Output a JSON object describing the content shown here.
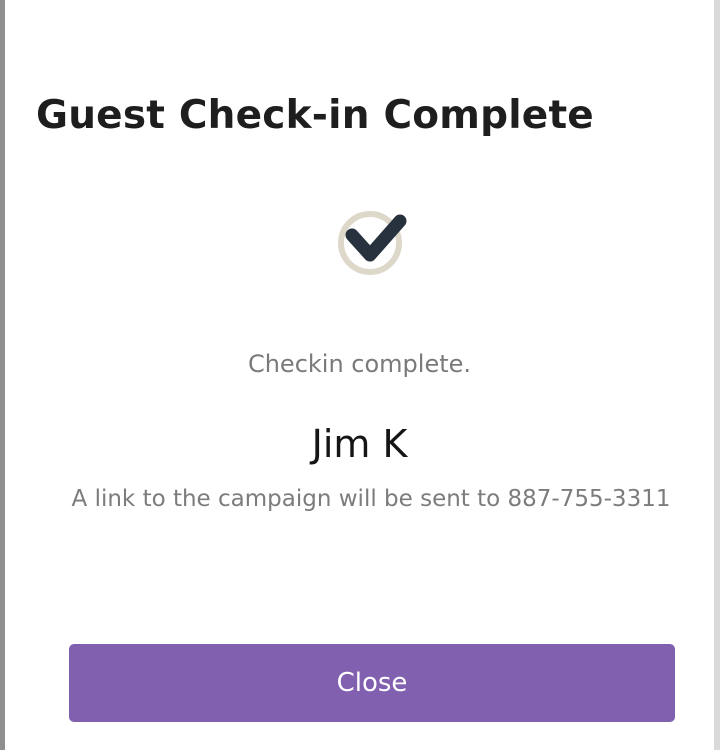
{
  "dialog": {
    "title": "Guest Check-in Complete",
    "status_icon": "check-circle-icon",
    "status_text": "Checkin complete.",
    "guest_name": "Jim K",
    "note": "A link to the campaign will be sent to 887-755-3311",
    "close_label": "Close"
  },
  "colors": {
    "accent": "#8260b0",
    "check": "#28323f",
    "check_ring": "#ddd8c9",
    "title_text": "#1e1e1e",
    "muted_text": "#7a7a7a"
  }
}
